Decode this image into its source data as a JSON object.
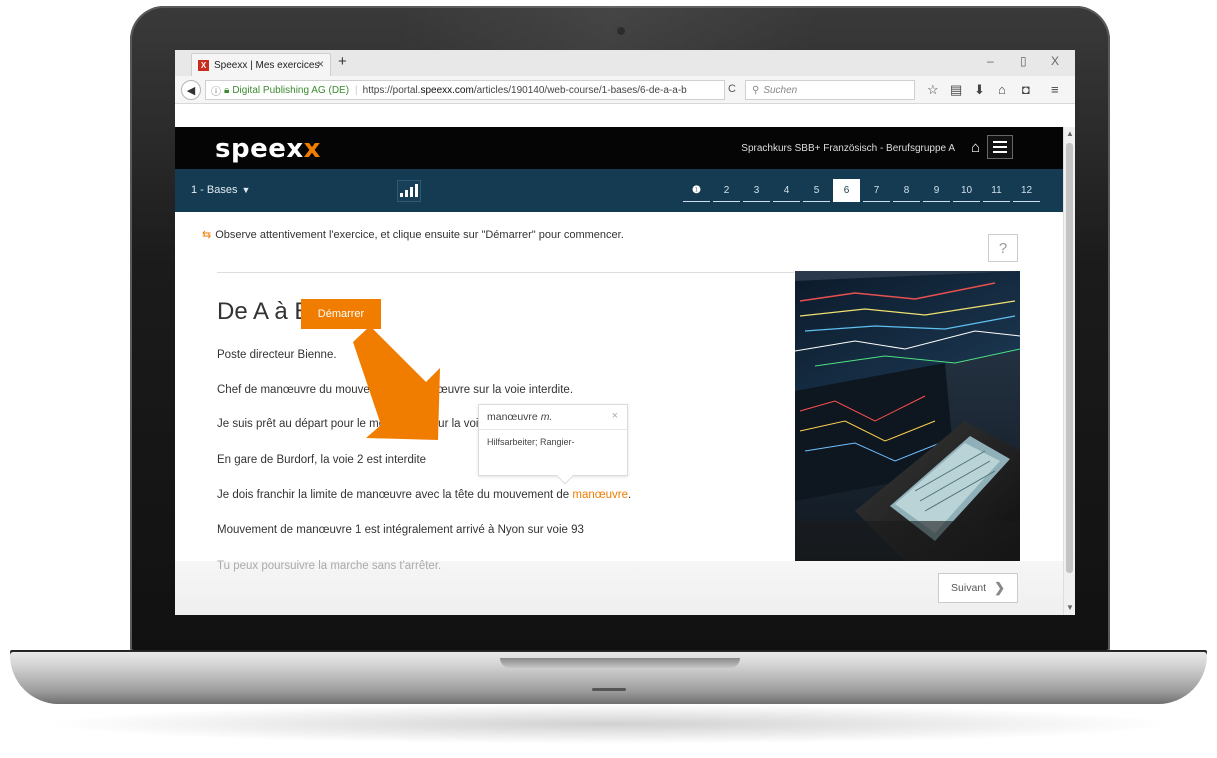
{
  "browser": {
    "tab_title": "Speexx | Mes exercices",
    "tab_favicon": "X",
    "url_site_identity": "Digital Publishing AG (DE)",
    "url_prefix": "https://portal.",
    "url_host": "speexx.com",
    "url_path": "/articles/190140/web-course/1-bases/6-de-a-a-b",
    "search_placeholder": "Suchen",
    "window_controls": {
      "minimize": "–",
      "maximize": "▢",
      "close": "X"
    }
  },
  "header": {
    "logo_main": "speex",
    "logo_accent": "x",
    "course_title": "Sprachkurs SBB+ Französisch - Berufsgruppe A"
  },
  "subnav": {
    "lesson_label": "1 - Bases",
    "pages": [
      "2",
      "3",
      "4",
      "5",
      "6",
      "7",
      "8",
      "9",
      "10",
      "11",
      "12"
    ],
    "active_page": "6"
  },
  "content": {
    "instruction": "Observe attentivement l'exercice, et clique ensuite sur \"Démarrer\" pour commencer.",
    "help_label": "?",
    "title": "De A à B",
    "start_label": "Démarrer",
    "sentences": [
      {
        "text": "Poste directeur Bienne."
      },
      {
        "text": "Chef de manœuvre du mouvement de manœuvre sur la voie interdite."
      },
      {
        "text": "Je suis prêt au départ pour le mouvement sur la voie 917"
      },
      {
        "text": "En gare de Burdorf, la voie 2 est interdite"
      },
      {
        "text_before": "Je dois franchir la limite de manœuvre avec la tête du mouvement de ",
        "highlight": "manœuvre",
        "text_after": "."
      },
      {
        "text": "Mouvement de manœuvre 1 est intégralement arrivé à Nyon sur voie 93"
      },
      {
        "text": "Tu peux poursuivre la marche sans t'arrêter."
      }
    ],
    "next_label": "Suivant"
  },
  "tooltip": {
    "word": "manœuvre",
    "gender": "m.",
    "close": "×",
    "translation": "Hilfsarbeiter; Rangier-"
  },
  "colors": {
    "accent": "#f07d00",
    "header_bg": "#050505",
    "subnav_bg": "#153b52"
  },
  "icons": {
    "back": "arrow-left-icon",
    "reload": "reload-icon",
    "search": "search-icon",
    "bookmark": "star-icon",
    "home": "home-icon",
    "menu": "hamburger-icon",
    "stats": "bar-chart-icon",
    "info": "info-icon"
  }
}
